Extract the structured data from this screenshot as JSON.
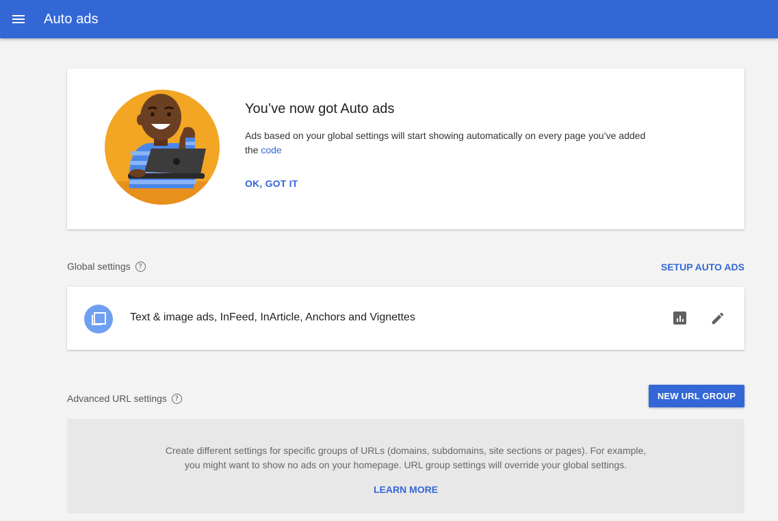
{
  "header": {
    "title": "Auto ads",
    "menu_icon": "hamburger-menu-icon",
    "color": "#3367d6"
  },
  "promo": {
    "title": "You’ve now got Auto ads",
    "body_prefix": "Ads based on your global settings will start showing automatically on every page you’ve added the ",
    "body_link": "code",
    "action": "OK, GOT IT"
  },
  "global_settings": {
    "label": "Global settings",
    "help_icon": "?",
    "setup_action": "SETUP AUTO ADS",
    "item_text": "Text & image ads, InFeed, InArticle, Anchors and Vignettes",
    "icons": [
      "ad-formats-icon",
      "bar-chart-icon",
      "edit-pencil-icon"
    ]
  },
  "advanced_url_settings": {
    "label": "Advanced URL settings",
    "help_icon": "?",
    "new_group_action": "NEW URL GROUP",
    "description_line1": "Create different settings for specific groups of URLs (domains, subdomains, site sections or pages). For example,",
    "description_line2": "you might want to show no ads on your homepage. URL group settings will override your global settings.",
    "learn_more": "LEARN MORE"
  }
}
